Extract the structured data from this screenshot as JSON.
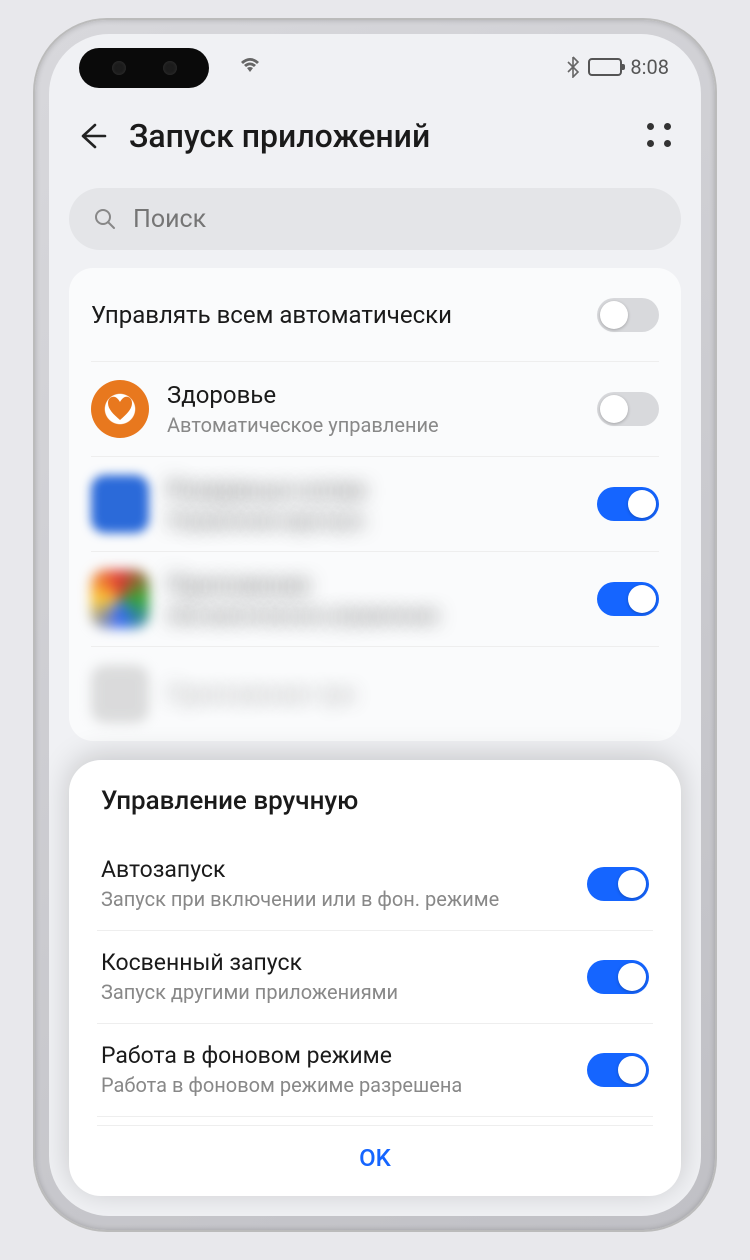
{
  "status": {
    "time": "8:08"
  },
  "header": {
    "title": "Запуск приложений"
  },
  "search": {
    "placeholder": "Поиск"
  },
  "master": {
    "label": "Управлять всем автоматически",
    "on": false
  },
  "apps": [
    {
      "name": "Здоровье",
      "sub": "Автоматическое управление",
      "on": false,
      "icon": "health",
      "blurred": false
    },
    {
      "name": "Резервные копии",
      "sub": "Управление вручную",
      "on": true,
      "icon": "blue",
      "blurred": true
    },
    {
      "name": "Приложение",
      "sub": "Автоматическое управление",
      "on": true,
      "icon": "multi",
      "blurred": true
    }
  ],
  "sheet": {
    "title": "Управление вручную",
    "rows": [
      {
        "title": "Автозапуск",
        "sub": "Запуск при включении или в фон. режиме",
        "on": true
      },
      {
        "title": "Косвенный запуск",
        "sub": "Запуск другими приложениями",
        "on": true
      },
      {
        "title": "Работа в фоновом режиме",
        "sub": "Работа в фоновом режиме разрешена",
        "on": true
      }
    ],
    "ok": "OK"
  }
}
